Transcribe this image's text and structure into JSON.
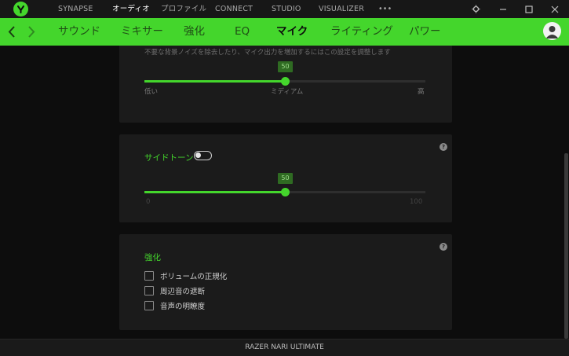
{
  "topnav": {
    "items": [
      "SYNAPSE",
      "オーディオ",
      "プロファイル",
      "CONNECT",
      "STUDIO",
      "VISUALIZER"
    ],
    "more": "•••"
  },
  "subnav": {
    "items": [
      "サウンド",
      "ミキサー",
      "強化",
      "EQ",
      "マイク",
      "ライティング",
      "パワー"
    ],
    "active": "マイク"
  },
  "noise_panel": {
    "description": "不要な背景ノイズを除去したり、マイク出力を増加するにはこの設定を調整します",
    "value": "50",
    "level": 0.5,
    "min_label": "低い",
    "mid_label": "ミディアム",
    "max_label": "高"
  },
  "sidetone_panel": {
    "title": "サイドトーン",
    "toggle_on": false,
    "value": "50",
    "level": 0.5,
    "min_label": "0",
    "max_label": "100",
    "help": "?"
  },
  "enhance_panel": {
    "title": "強化",
    "help": "?",
    "options": [
      "ボリュームの正規化",
      "周辺音の遮断",
      "音声の明瞭度"
    ]
  },
  "footer": {
    "device": "RAZER NARI ULTIMATE"
  },
  "colors": {
    "accent": "#44d62c",
    "background": "#0d0d0d",
    "panel": "#1b1b1b"
  }
}
